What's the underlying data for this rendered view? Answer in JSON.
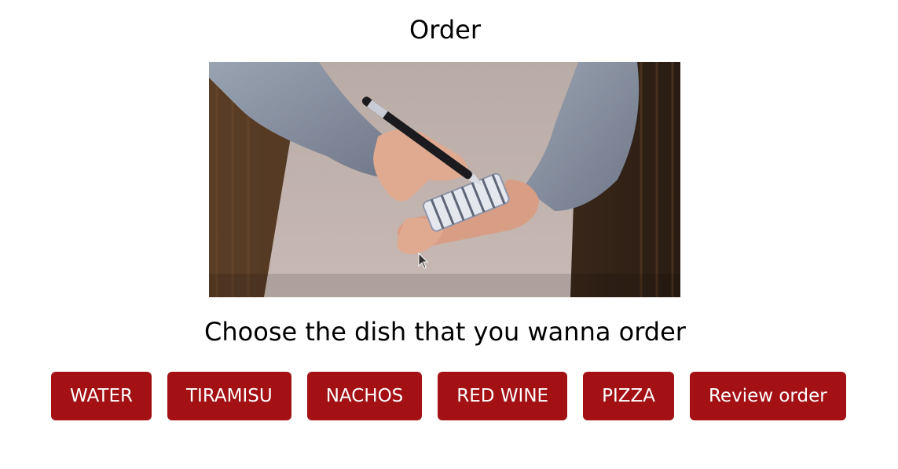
{
  "page": {
    "title": "Order",
    "hero_image": {
      "alt_subject": "waiter-holding-notepad-and-pen"
    },
    "prompt": "Choose the dish that you wanna order"
  },
  "dishes": [
    {
      "label": "WATER"
    },
    {
      "label": "TIRAMISU"
    },
    {
      "label": "NACHOS"
    },
    {
      "label": "RED WINE"
    },
    {
      "label": "PIZZA"
    }
  ],
  "actions": {
    "review_label": "Review order"
  },
  "colors": {
    "button_bg": "#a31114",
    "button_text": "#ffffff",
    "background": "#ffffff",
    "text": "#000000"
  }
}
